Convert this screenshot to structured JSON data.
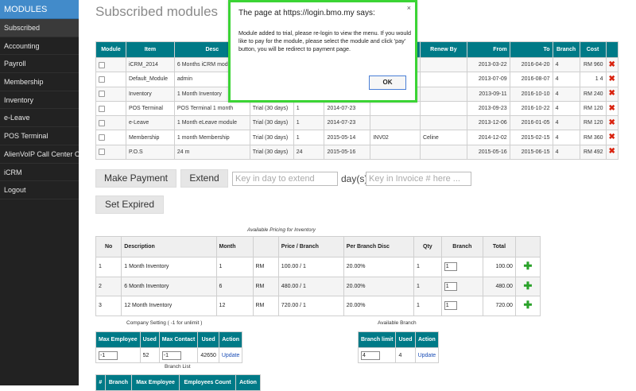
{
  "sidebar": {
    "header": "MODULES",
    "items": [
      {
        "label": "Subscribed"
      },
      {
        "label": "Accounting"
      },
      {
        "label": "Payroll"
      },
      {
        "label": "Membership"
      },
      {
        "label": "Inventory"
      },
      {
        "label": "e-Leave"
      },
      {
        "label": "POS Terminal"
      },
      {
        "label": "AlienVoIP Call Center Cl"
      },
      {
        "label": "iCRM"
      },
      {
        "label": "Logout"
      }
    ]
  },
  "main": {
    "title": "Subscribed modules",
    "subscribed_table": {
      "headers": [
        "Module",
        "Item",
        "Desc",
        "",
        "",
        "",
        "",
        "Renew By",
        "From",
        "To",
        "Branch",
        "Cost",
        ""
      ],
      "rows": [
        {
          "item": "iCRM_2014",
          "desc": "6 Months iCRM modu",
          "c4": "",
          "c5": "",
          "c6": "",
          "c7": "",
          "renew_by": "",
          "from": "2013-03-22",
          "to": "2016-04-20",
          "branch": "4",
          "cost": "RM 960"
        },
        {
          "item": "Default_Module",
          "desc": "admin",
          "c4": "",
          "c5": "",
          "c6": "",
          "c7": "",
          "renew_by": "",
          "from": "2013-07-09",
          "to": "2016-08-07",
          "branch": "4",
          "cost": "1 4"
        },
        {
          "item": "Inventory",
          "desc": "1 Month Inventory",
          "c4": "",
          "c5": "",
          "c6": "",
          "c7": "",
          "renew_by": "",
          "from": "2013-09-11",
          "to": "2016-10-10",
          "branch": "4",
          "cost": "RM 240"
        },
        {
          "item": "POS Terminal",
          "desc": "POS Terminal 1 month",
          "c4": "Trial (30 days)",
          "c5": "1",
          "c6": "2014-07-23",
          "c7": "",
          "renew_by": "",
          "from": "2013-09-23",
          "to": "2016-10-22",
          "branch": "4",
          "cost": "RM 120"
        },
        {
          "item": "e-Leave",
          "desc": "1 Month eLeave module",
          "c4": "Trial (30 days)",
          "c5": "1",
          "c6": "2014-07-23",
          "c7": "",
          "renew_by": "",
          "from": "2013-12-06",
          "to": "2016-01-05",
          "branch": "4",
          "cost": "RM 120"
        },
        {
          "item": "Membership",
          "desc": "1 month Membership",
          "c4": "Trial (30 days)",
          "c5": "1",
          "c6": "2015-05-14",
          "c7": "INV02",
          "renew_by": "Celine",
          "from": "2014-12-02",
          "to": "2015-02-15",
          "branch": "4",
          "cost": "RM 360"
        },
        {
          "item": "P.O.S",
          "desc": "24 m",
          "c4": "Trial (30 days)",
          "c5": "24",
          "c6": "2015-05-16",
          "c7": "",
          "renew_by": "",
          "from": "2015-05-16",
          "to": "2015-06-15",
          "branch": "4",
          "cost": "RM 492"
        }
      ]
    },
    "buttons": {
      "make_payment": "Make Payment",
      "extend": "Extend",
      "set_expired": "Set Expired"
    },
    "inputs": {
      "extend_days_placeholder": "Key in day to extend",
      "days_label": "day(s)",
      "invoice_placeholder": "Key in Invoice # here ..."
    },
    "pricing": {
      "caption": "Available Pricing for Inventory",
      "headers": [
        "No",
        "Description",
        "Month",
        "",
        "Price / Branch",
        "Per Branch Disc",
        "Qty",
        "Branch",
        "Total",
        ""
      ],
      "rows": [
        {
          "no": "1",
          "desc": "1 Month Inventory",
          "month": "1",
          "cur": "RM",
          "price": "100.00 / 1",
          "disc": "20.00%",
          "qty": "1",
          "branch": "1",
          "total": "100.00"
        },
        {
          "no": "2",
          "desc": "6 Month Inventory",
          "month": "6",
          "cur": "RM",
          "price": "480.00 / 1",
          "disc": "20.00%",
          "qty": "1",
          "branch": "1",
          "total": "480.00"
        },
        {
          "no": "3",
          "desc": "12 Month Inventory",
          "month": "12",
          "cur": "RM",
          "price": "720.00 / 1",
          "disc": "20.00%",
          "qty": "1",
          "branch": "1",
          "total": "720.00"
        }
      ]
    },
    "company_setting": {
      "caption": "Company Setting ( -1 for unlimit )",
      "headers": [
        "Max Employee",
        "Used",
        "Max Contact",
        "Used",
        "Action"
      ],
      "row": {
        "max_employee": "-1",
        "used1": "52",
        "max_contact": "-1",
        "used2": "42650",
        "action": "Update"
      }
    },
    "available_branch": {
      "caption": "Available Branch",
      "headers": [
        "Branch limit",
        "Used",
        "Action"
      ],
      "row": {
        "limit": "4",
        "used": "4",
        "action": "Update"
      }
    },
    "branch_list": {
      "caption": "Branch List",
      "headers": [
        "#",
        "Branch",
        "Max Employee",
        "Employees Count",
        "Action"
      ]
    }
  },
  "dialog": {
    "title": "The page at https://login.bmo.my says:",
    "close": "×",
    "message": "Module added to trial, please re-login to view the menu. If you would like to pay for the module, please select the module and click 'pay' button, you will be redirect to payment page.",
    "ok": "OK"
  }
}
